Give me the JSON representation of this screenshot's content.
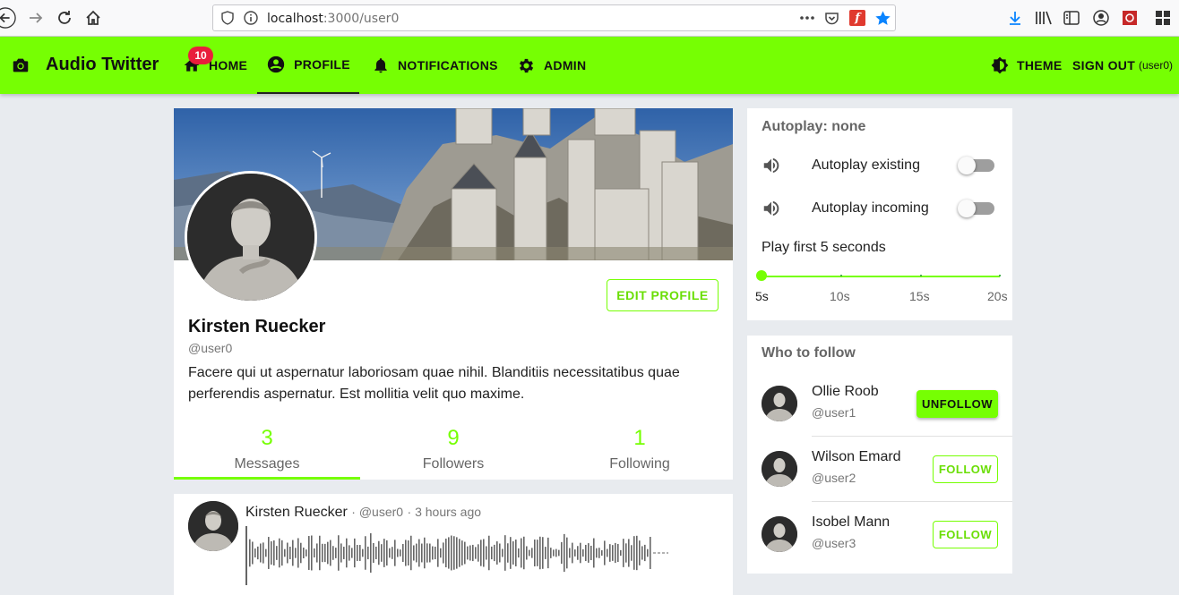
{
  "browser": {
    "url_host": "localhost",
    "url_path": ":3000/user0",
    "icons": [
      "back-icon",
      "forward-icon",
      "reload-icon",
      "home-icon",
      "shield-icon",
      "info-icon",
      "more-icon",
      "pocket-icon",
      "extension-icon",
      "bookmark-star-icon",
      "download-icon",
      "library-icon",
      "sidebar-icon",
      "account-icon",
      "addon-icon",
      "menu-icon"
    ]
  },
  "appbar": {
    "brand": "Audio Twitter",
    "nav": [
      {
        "label": "HOME",
        "icon": "home-icon"
      },
      {
        "label": "PROFILE",
        "icon": "account-circle-icon"
      },
      {
        "label": "NOTIFICATIONS",
        "icon": "bell-icon"
      },
      {
        "label": "ADMIN",
        "icon": "gear-icon"
      }
    ],
    "home_badge": "10",
    "theme_label": "THEME",
    "signout_label": "SIGN OUT",
    "signed_in_user": "(user0)",
    "accent_color": "#76ff03"
  },
  "profile": {
    "name": "Kirsten Ruecker",
    "handle": "@user0",
    "bio": "Facere qui ut aspernatur laboriosam quae nihil. Blanditiis necessitatibus quae perferendis aspernatur. Est mollitia velit quo maxime.",
    "edit_label": "EDIT PROFILE",
    "stats": [
      {
        "value": "3",
        "label": "Messages"
      },
      {
        "value": "9",
        "label": "Followers"
      },
      {
        "value": "1",
        "label": "Following"
      }
    ],
    "active_stat": 0
  },
  "post": {
    "author": "Kirsten Ruecker",
    "handle": "@user0",
    "time": "3 hours ago"
  },
  "autoplay": {
    "heading": "Autoplay: none",
    "existing_label": "Autoplay existing",
    "incoming_label": "Autoplay incoming",
    "existing_on": false,
    "incoming_on": false,
    "play_first_label": "Play first 5 seconds",
    "slider_marks": [
      "5s",
      "10s",
      "15s",
      "20s"
    ],
    "slider_value_seconds": 5
  },
  "who_to_follow": {
    "heading": "Who to follow",
    "users": [
      {
        "name": "Ollie Roob",
        "handle": "@user1",
        "action": "UNFOLLOW"
      },
      {
        "name": "Wilson Emard",
        "handle": "@user2",
        "action": "FOLLOW"
      },
      {
        "name": "Isobel Mann",
        "handle": "@user3",
        "action": "FOLLOW"
      }
    ]
  }
}
